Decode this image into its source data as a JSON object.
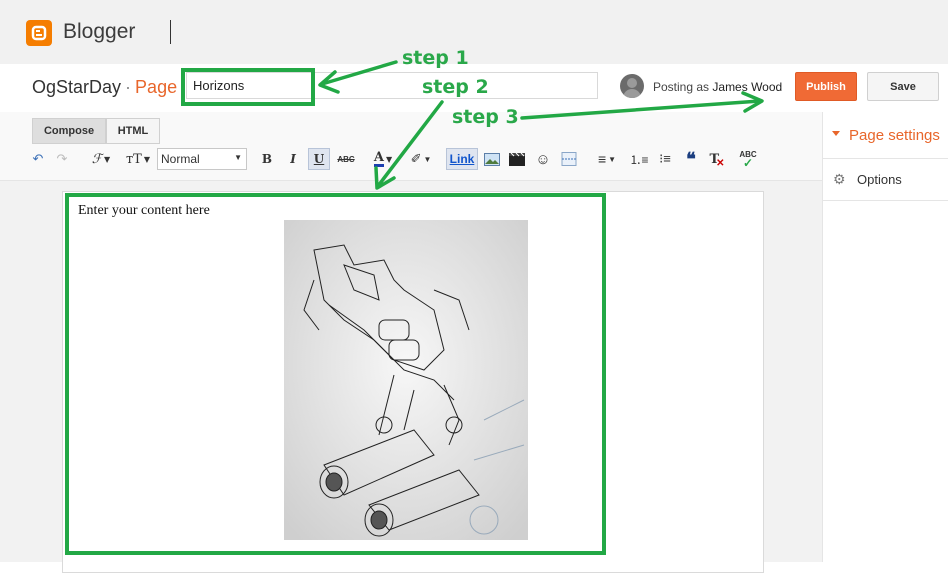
{
  "app": {
    "brand": "Blogger"
  },
  "titlebar": {
    "blog_name": "OgStarDay",
    "separator": "·",
    "kind": "Page",
    "title_value": "Horizons",
    "posting_prefix": "Posting as",
    "user_name": "James Wood",
    "publish_label": "Publish",
    "save_label": "Save"
  },
  "toolbar": {
    "compose_label": "Compose",
    "html_label": "HTML",
    "font_size_value": "Normal",
    "link_label": "Link",
    "icons": [
      "undo-icon",
      "redo-icon",
      "font-family-icon",
      "font-size-icon",
      "bold-icon",
      "italic-icon",
      "underline-icon",
      "strikethrough-icon",
      "text-color-icon",
      "highlight-icon",
      "link-icon",
      "image-icon",
      "video-icon",
      "emoji-icon",
      "jump-break-icon",
      "align-icon",
      "numbered-list-icon",
      "bullet-list-icon",
      "quote-icon",
      "clear-format-icon",
      "spellcheck-icon"
    ]
  },
  "sidebar": {
    "page_settings_label": "Page settings",
    "options_label": "Options"
  },
  "editor": {
    "content_text": "Enter your content here"
  },
  "annotations": {
    "step1": "step 1",
    "step2": "step 2",
    "step3": "step 3",
    "color": "#22a845"
  },
  "colors": {
    "brand_orange": "#f57d00",
    "publish": "#f06a35",
    "accent": "#e8662b"
  }
}
